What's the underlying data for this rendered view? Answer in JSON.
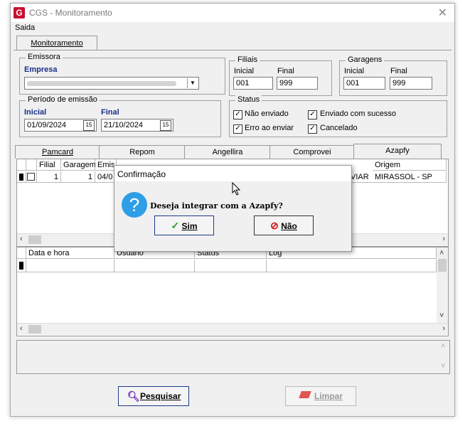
{
  "window": {
    "title": "CGS - Monitoramento",
    "logo": "G"
  },
  "menu": {
    "saida": "Saida"
  },
  "main_tab": {
    "label": "Monitoramento"
  },
  "emissora": {
    "title": "Emissora",
    "empresa_label": "Empresa"
  },
  "filiais": {
    "title": "Filiais",
    "inicial_label": "Inicial",
    "final_label": "Final",
    "inicial_value": "001",
    "final_value": "999"
  },
  "garagens": {
    "title": "Garagens",
    "inicial_label": "Inicial",
    "final_label": "Final",
    "inicial_value": "001",
    "final_value": "999"
  },
  "periodo": {
    "title": "Período de emissão",
    "inicial_label": "Inicial",
    "final_label": "Final",
    "inicial_value": "01/09/2024",
    "final_value": "21/10/2024",
    "cal_glyph": "15"
  },
  "status": {
    "title": "Status",
    "nao_enviado": "Não enviado",
    "enviado_sucesso": "Enviado com sucesso",
    "erro_enviar": "Erro ao enviar",
    "cancelado": "Cancelado",
    "check": "✓"
  },
  "api_tabs": [
    "Pamcard",
    "Repom",
    "Angellira",
    "Comprovei",
    "Azapfy"
  ],
  "grid1": {
    "headers": [
      "Filial",
      "Garagem",
      "Emis",
      "Origem"
    ],
    "row": {
      "filial": "1",
      "garagem": "1",
      "emissao": "04/0",
      "status_tail": "VIAR",
      "origem": "MIRASSOL - SP"
    }
  },
  "grid2": {
    "headers": [
      "Data e hora",
      "Usuário",
      "Status",
      "Log"
    ]
  },
  "buttons": {
    "pesquisar": "Pesquisar",
    "limpar": "Limpar"
  },
  "dialog": {
    "title": "Confirmação",
    "message": "Deseja integrar com a Azapfy?",
    "sim": "Sim",
    "nao": "Não"
  },
  "colors": {
    "accent_blue": "#1a2f8a",
    "question_icon": "#2e9ee6",
    "logo_red": "#c8102e",
    "no_red": "#d01010",
    "yes_green": "#2a9d2a"
  }
}
